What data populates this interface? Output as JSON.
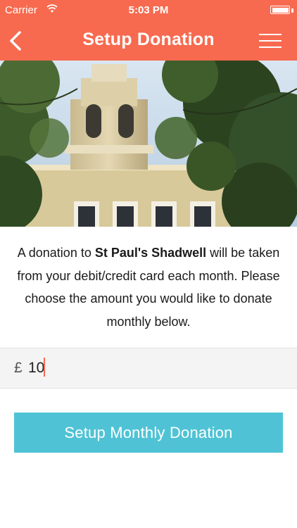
{
  "status_bar": {
    "carrier": "Carrier",
    "time": "5:03 PM"
  },
  "nav": {
    "title": "Setup Donation",
    "back_icon": "chevron-left-icon",
    "menu_icon": "hamburger-menu-icon",
    "color": "#f76a4f"
  },
  "hero": {
    "image": "church-photo"
  },
  "description": {
    "prefix": "A donation to ",
    "church_name": "St Paul's Shadwell",
    "suffix": " will be taken from your debit/credit card each month. Please choose the amount you would like to donate monthly below."
  },
  "amount": {
    "currency_symbol": "£",
    "value": "10"
  },
  "donate_button": {
    "label": "Setup Monthly Donation",
    "color": "#4fc3d5"
  }
}
